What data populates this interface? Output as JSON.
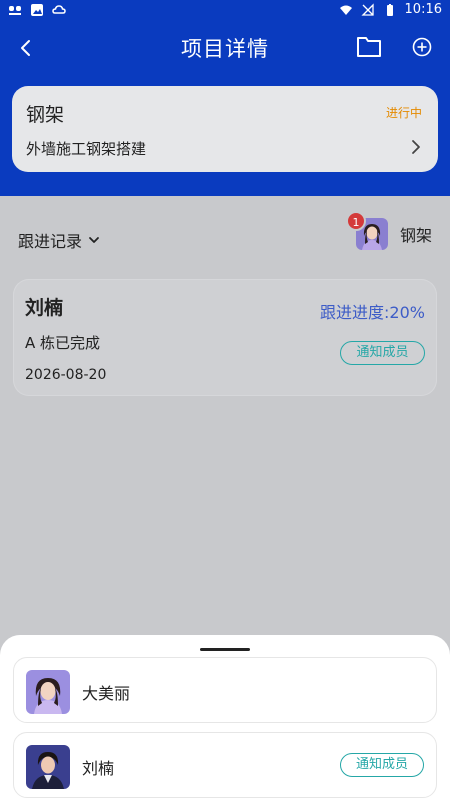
{
  "status_bar": {
    "time": "10:16",
    "icons": [
      "app-icon",
      "image-icon",
      "cloud-icon",
      "wifi-icon",
      "signal-off-icon",
      "battery-icon"
    ]
  },
  "header": {
    "title": "项目详情",
    "icons": [
      "back-icon",
      "folder-icon",
      "add-circle-icon"
    ]
  },
  "project": {
    "name": "钢架",
    "status": "进行中",
    "status_color": "#e48a00",
    "description": "外墙施工钢架搭建"
  },
  "followup": {
    "label": "跟进记录",
    "member_badge": "1",
    "member_name": "钢架"
  },
  "record": {
    "author": "刘楠",
    "progress_text": "跟进进度:20%",
    "content": "A 栋已完成",
    "date": "2026-08-20",
    "notify_label": "通知成员"
  },
  "sheet": {
    "items": [
      {
        "name": "大美丽",
        "notify_label": ""
      },
      {
        "name": "刘楠",
        "notify_label": "通知成员"
      }
    ]
  },
  "colors": {
    "header_bg": "#0a3bbf",
    "accent_teal": "#25a7a7",
    "progress_blue": "#3d5cc7",
    "badge_red": "#d43a3a"
  }
}
